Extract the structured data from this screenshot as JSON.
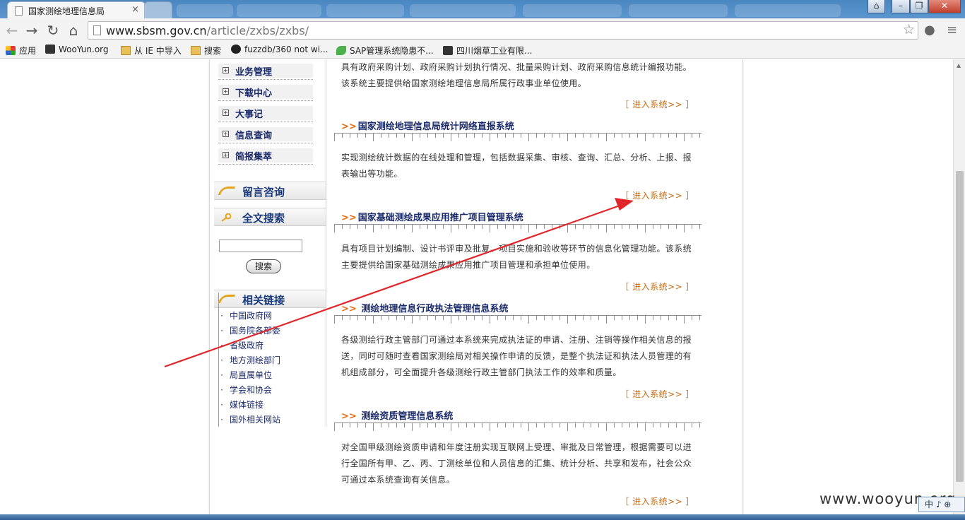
{
  "browser": {
    "tab_title": "国家测绘地理信息局",
    "tab_close": "×",
    "url_host": "www.sbsm.gov.cn",
    "url_path": "/article/zxbs/zxbs/",
    "bookmarks": [
      "应用",
      "WooYun.org",
      "从 IE 中导入",
      "搜索",
      "fuzzdb/360 not wi...",
      "SAP管理系统隐患不...",
      "四川烟草工业有限..."
    ]
  },
  "sidebar": {
    "menu": [
      "业务管理",
      "下载中心",
      "大事记",
      "信息查询",
      "简报集萃"
    ],
    "message_title": "留言咨询",
    "search_title": "全文搜索",
    "search_button": "搜索",
    "links_title": "相关链接",
    "links": [
      "中国政府网",
      "国务院各部委",
      "省级政府",
      "地方测绘部门",
      "局直属单位",
      "学会和协会",
      "媒体链接",
      "国外相关网站"
    ]
  },
  "main": {
    "enter_label": "［ 进入系统>> ］",
    "top_desc": "具有政府采购计划、政府采购计划执行情况、批量采购计划、政府采购信息统计编报功能。该系统主要提供给国家测绘地理信息局所属行政事业单位使用。",
    "systems": [
      {
        "title": "国家测绘地理信息局统计网络直报系统",
        "desc": "实现测绘统计数据的在线处理和管理，包括数据采集、审核、查询、汇总、分析、上报、报表输出等功能。"
      },
      {
        "title": "国家基础测绘成果应用推广项目管理系统",
        "desc": "具有项目计划编制、设计书评审及批复、项目实施和验收等环节的信息化管理功能。该系统主要提供给国家基础测绘成果应用推广项目管理和承担单位使用。"
      },
      {
        "title": " 测绘地理信息行政执法管理信息系统",
        "desc": "各级测绘行政主管部门可通过本系统来完成执法证的申请、注册、注销等操作相关信息的报送，同时可随时查看国家测绘局对相关操作申请的反馈，是整个执法证和执法人员管理的有机组成部分，可全面提升各级测绘行政主管部门执法工作的效率和质量。"
      },
      {
        "title": " 测绘资质管理信息系统",
        "desc": "对全国甲级测绘资质申请和年度注册实现互联网上受理、审批及日常管理，根据需要可以进行全国所有甲、乙、丙、丁测绘单位和人员信息的汇集、统计分析、共享和发布，社会公众可通过本系统查询有关信息。"
      }
    ]
  },
  "overlay": {
    "watermark": "www.wooyun.org",
    "ime": "中 ♪ ⊕",
    "annotation_color": "#e0262a"
  },
  "icons": [
    "back-icon",
    "forward-icon",
    "reload-icon",
    "home-icon",
    "star-icon",
    "cookie-icon",
    "menu-icon"
  ]
}
